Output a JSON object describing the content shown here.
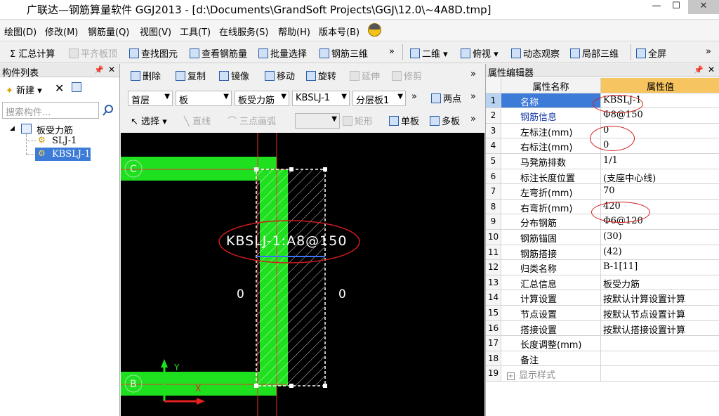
{
  "window": {
    "title": "广联达—钢筋算量软件 GGJ2013 - [d:\\Documents\\GrandSoft Projects\\GGJ\\12.0\\~4A8D.tmp]",
    "minimize": "—",
    "maximize": "☐",
    "close": "✕"
  },
  "menu": [
    "绘图(D)",
    "修改(M)",
    "钢筋量(Q)",
    "视图(V)",
    "工具(T)",
    "在线服务(S)",
    "帮助(H)",
    "版本号(B)"
  ],
  "toolbar": {
    "sum_calc": "Σ 汇总计算",
    "flat_slab": "平齐板顶",
    "find_element": "查找图元",
    "view_rebar": "查看钢筋量",
    "batch_select": "批量选择",
    "rebar_3d": "钢筋三维",
    "view_2d": "二维",
    "top_view": "俯视",
    "dynamic_view": "动态观察",
    "local_3d": "局部三维",
    "fullscreen": "全屏",
    "more": "»"
  },
  "left_panel": {
    "title": "构件列表",
    "new_button": "新建",
    "search_placeholder": "搜索构件...",
    "tree": {
      "root": "板受力筋",
      "items": [
        "SLJ-1",
        "KBSLJ-1"
      ]
    }
  },
  "cad_toolbar": {
    "delete": "删除",
    "copy": "复制",
    "mirror": "镜像",
    "move": "移动",
    "rotate": "旋转",
    "extend": "延伸",
    "trim": "修剪",
    "floor": "首层",
    "type": "板",
    "category": "板受力筋",
    "element": "KBSLJ-1",
    "layer": "分层板1",
    "two_points": "两点",
    "select": "选择",
    "line": "直线",
    "arc": "三点画弧",
    "rect": "矩形",
    "single_slab": "单板",
    "multi_slab": "多板"
  },
  "canvas": {
    "axis_c": "C",
    "axis_b": "B",
    "rebar_label": "KBSLJ-1:A8@150",
    "left_mark": "0",
    "right_mark": "0",
    "y_axis": "Y",
    "x_axis": "X"
  },
  "properties": {
    "title": "属性编辑器",
    "col_name": "属性名称",
    "col_value": "属性值",
    "rows": [
      {
        "idx": "1",
        "name": "名称",
        "value": "KBSLJ-1"
      },
      {
        "idx": "2",
        "name": "钢筋信息",
        "value": "Φ8@150"
      },
      {
        "idx": "3",
        "name": "左标注(mm)",
        "value": "0"
      },
      {
        "idx": "4",
        "name": "右标注(mm)",
        "value": "0"
      },
      {
        "idx": "5",
        "name": "马凳筋排数",
        "value": "1/1"
      },
      {
        "idx": "6",
        "name": "标注长度位置",
        "value": "(支座中心线)"
      },
      {
        "idx": "7",
        "name": "左弯折(mm)",
        "value": "70"
      },
      {
        "idx": "8",
        "name": "右弯折(mm)",
        "value": "420"
      },
      {
        "idx": "9",
        "name": "分布钢筋",
        "value": "Φ6@120"
      },
      {
        "idx": "10",
        "name": "钢筋锚固",
        "value": "(30)"
      },
      {
        "idx": "11",
        "name": "钢筋搭接",
        "value": "(42)"
      },
      {
        "idx": "12",
        "name": "归类名称",
        "value": "B-1[11]"
      },
      {
        "idx": "13",
        "name": "汇总信息",
        "value": "板受力筋"
      },
      {
        "idx": "14",
        "name": "计算设置",
        "value": "按默认计算设置计算"
      },
      {
        "idx": "15",
        "name": "节点设置",
        "value": "按默认节点设置计算"
      },
      {
        "idx": "16",
        "name": "搭接设置",
        "value": "按默认搭接设置计算"
      },
      {
        "idx": "17",
        "name": "长度调整(mm)",
        "value": ""
      },
      {
        "idx": "18",
        "name": "备注",
        "value": ""
      },
      {
        "idx": "19",
        "name": "显示样式",
        "value": ""
      }
    ]
  },
  "colors": {
    "beam_green": "#1fe01f",
    "selection_blue": "#3d7bd9",
    "annotation_red": "#d21c1c",
    "header_orange": "#f7c560"
  }
}
